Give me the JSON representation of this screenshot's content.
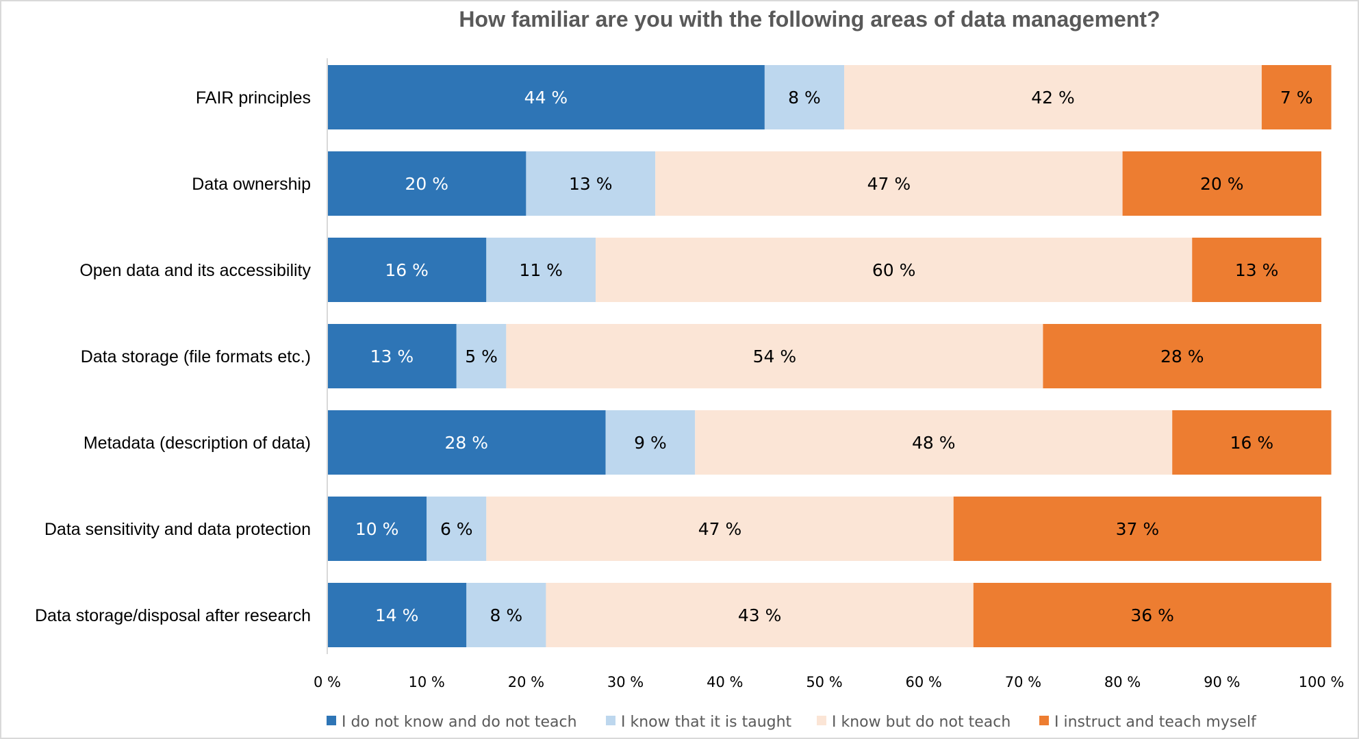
{
  "chart_data": {
    "type": "bar",
    "orientation": "horizontal",
    "stacked": true,
    "title": "How familiar are you with the following areas of data management?",
    "xlabel": "",
    "ylabel": "",
    "xlim": [
      0,
      100
    ],
    "x_ticks": [
      "0 %",
      "10 %",
      "20 %",
      "30 %",
      "40 %",
      "50 %",
      "60 %",
      "70 %",
      "80 %",
      "90 %",
      "100 %"
    ],
    "grid": false,
    "legend_position": "bottom",
    "categories": [
      "FAIR principles",
      "Data ownership",
      "Open data and its accessibility",
      "Data storage (file formats etc.)",
      "Metadata (description of data)",
      "Data sensitivity and data protection",
      "Data storage/disposal after research"
    ],
    "series": [
      {
        "name": "I do not know and do not teach",
        "color": "#2e75b6",
        "label_color": "#ffffff",
        "values": [
          44,
          20,
          16,
          13,
          28,
          10,
          14
        ]
      },
      {
        "name": "I know that it is taught",
        "color": "#bdd7ee",
        "label_color": "#000000",
        "values": [
          8,
          13,
          11,
          5,
          9,
          6,
          8
        ]
      },
      {
        "name": "I know but do not teach",
        "color": "#fbe5d6",
        "label_color": "#000000",
        "values": [
          42,
          47,
          60,
          54,
          48,
          47,
          43
        ]
      },
      {
        "name": "I instruct and teach myself",
        "color": "#ed7d31",
        "label_color": "#000000",
        "values": [
          7,
          20,
          13,
          28,
          16,
          37,
          36
        ]
      }
    ],
    "value_suffix": " %"
  }
}
